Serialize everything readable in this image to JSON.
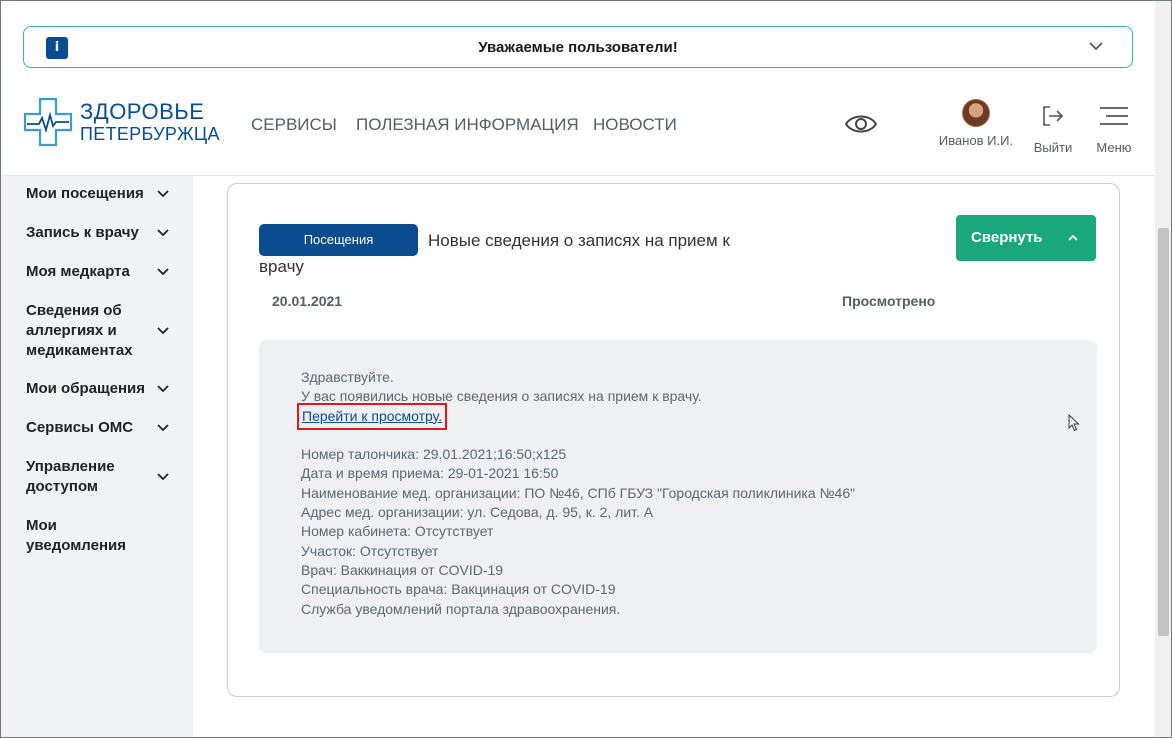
{
  "notice": {
    "title": "Уважаемые пользователи!",
    "badge": "i"
  },
  "logo": {
    "line1": "ЗДОРОВЬЕ",
    "line2": "ПЕТЕРБУРЖЦА"
  },
  "nav": {
    "items": [
      "СЕРВИСЫ",
      "ПОЛЕЗНАЯ ИНФОРМАЦИЯ",
      "НОВОСТИ"
    ]
  },
  "user": {
    "name": "Иванов И.И."
  },
  "actions": {
    "logout": "Выйти",
    "menu": "Меню"
  },
  "sidebar": {
    "items": [
      {
        "label": "Мои посещения",
        "chevron": true
      },
      {
        "label": "Запись к врачу",
        "chevron": true
      },
      {
        "label": "Моя медкарта",
        "chevron": true
      },
      {
        "label": "Сведения об аллергиях и медикаментах",
        "chevron": true
      },
      {
        "label": "Мои обращения",
        "chevron": true
      },
      {
        "label": "Сервисы ОМС",
        "chevron": true
      },
      {
        "label": "Управление доступом",
        "chevron": true
      },
      {
        "label": "Мои уведомления",
        "chevron": false
      }
    ]
  },
  "card": {
    "tag": "Посещения",
    "title": "Новые сведения о записях на прием к врачу",
    "collapse_label": "Свернуть",
    "date": "20.01.2021",
    "status": "Просмотрено",
    "message": {
      "greeting": "Здравствуйте.",
      "intro": "У вас появились новые сведения о записях на прием к врачу.",
      "link": "Перейти к просмотру.",
      "details": [
        "Номер талончика: 29.01.2021;16:50;x125",
        "Дата и время приема: 29-01-2021 16:50",
        "Наименование мед. организации: ПО №46, СПб ГБУЗ \"Городская поликлиника №46\"",
        "Адрес мед. организации: ул. Седова, д. 95, к. 2, лит. А",
        "Номер кабинета: Отсутствует",
        "Участок: Отсутствует",
        "Врач: Ваккинация от COVID-19",
        "Специальность врача: Вакцинация от COVID-19",
        "Служба уведомлений портала здравоохранения."
      ]
    }
  },
  "colors": {
    "brand": "#0a4c8f",
    "accent": "#1aa87a",
    "notice_border": "#3fb89a",
    "highlight": "#e3161b"
  }
}
